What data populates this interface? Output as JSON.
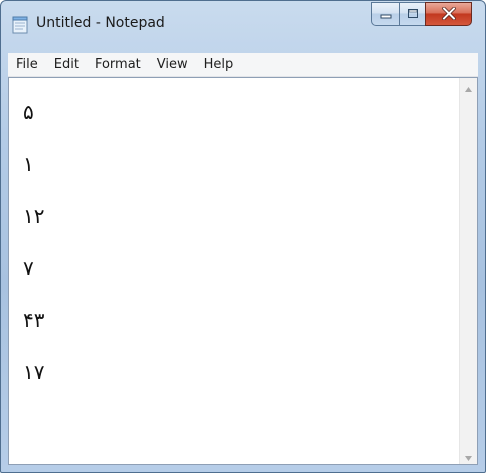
{
  "window": {
    "title": "Untitled - Notepad",
    "icon": "notepad-icon"
  },
  "menu": {
    "items": [
      {
        "label": "File"
      },
      {
        "label": "Edit"
      },
      {
        "label": "Format"
      },
      {
        "label": "View"
      },
      {
        "label": "Help"
      }
    ]
  },
  "editor": {
    "lines": [
      "۵",
      "۱",
      "۱۲",
      "۷",
      "۴۳",
      "۱۷"
    ]
  },
  "caption_buttons": [
    "minimize-icon",
    "maximize-icon",
    "close-icon"
  ],
  "colors": {
    "frame": "#b3cbe6",
    "close_button": "#c2381f",
    "menubar": "#f5f6f7"
  }
}
